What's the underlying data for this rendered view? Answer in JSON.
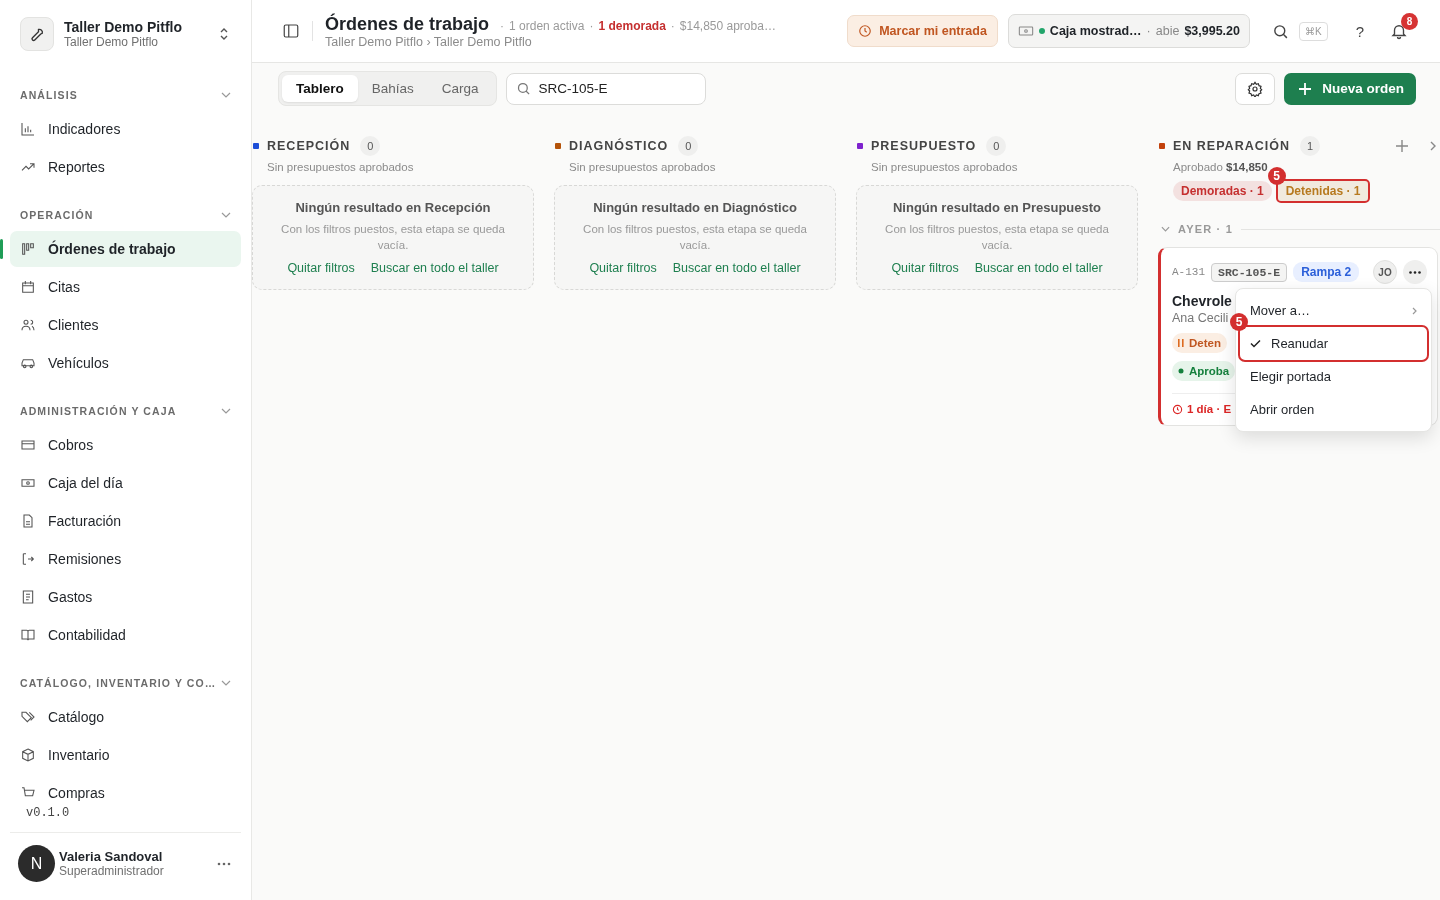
{
  "workspace": {
    "name": "Taller Demo Pitflo",
    "subtitle": "Taller Demo Pitflo"
  },
  "sidebar": {
    "sections": [
      {
        "title": "ANÁLISIS",
        "expanded": true,
        "items": [
          {
            "label": "Indicadores",
            "selected": false
          },
          {
            "label": "Reportes",
            "selected": false
          }
        ]
      },
      {
        "title": "OPERACIÓN",
        "expanded": true,
        "items": [
          {
            "label": "Órdenes de trabajo",
            "selected": true
          },
          {
            "label": "Citas",
            "selected": false
          },
          {
            "label": "Clientes",
            "selected": false
          },
          {
            "label": "Vehículos",
            "selected": false
          }
        ]
      },
      {
        "title": "ADMINISTRACIÓN Y CAJA",
        "expanded": true,
        "items": [
          {
            "label": "Cobros",
            "selected": false
          },
          {
            "label": "Caja del día",
            "selected": false
          },
          {
            "label": "Facturación",
            "selected": false
          },
          {
            "label": "Remisiones",
            "selected": false
          },
          {
            "label": "Gastos",
            "selected": false
          },
          {
            "label": "Contabilidad",
            "selected": false
          }
        ]
      },
      {
        "title": "CATÁLOGO, INVENTARIO Y CO…",
        "expanded": true,
        "items": [
          {
            "label": "Catálogo",
            "selected": false
          },
          {
            "label": "Inventario",
            "selected": false
          },
          {
            "label": "Compras",
            "selected": false
          }
        ]
      }
    ],
    "version": "v0.1.0",
    "user": {
      "initial": "N",
      "name": "Valeria Sandoval",
      "role": "Superadministrador"
    }
  },
  "header": {
    "title": "Órdenes de trabajo",
    "separator": "·",
    "meta": [
      {
        "text": "1 orden activa",
        "alert": false
      },
      {
        "text": "1 demorada",
        "alert": true
      },
      {
        "text": "$14,850 aproba…",
        "alert": false
      }
    ],
    "breadcrumb": "Taller Demo Pitflo › Taller Demo Pitflo",
    "clock_button": "Marcar mi entrada",
    "cash": {
      "open": true,
      "name": "Caja mostrad…",
      "separator": "·",
      "status": "abie",
      "amount": "$3,995.20"
    },
    "shortcut": "⌘K",
    "help": "?",
    "notifications": "8"
  },
  "toolbar": {
    "tabs": [
      {
        "label": "Tablero",
        "selected": true
      },
      {
        "label": "Bahías",
        "selected": false
      },
      {
        "label": "Carga",
        "selected": false
      }
    ],
    "search": {
      "value": "SRC-105-E"
    },
    "new_button": "Nueva orden"
  },
  "columns": [
    {
      "name": "RECEPCIÓN",
      "color": "#1d4ed8",
      "count": "0",
      "subtitle": "Sin presupuestos aprobados",
      "empty": {
        "title": "Ningún resultado en Recepción",
        "text": "Con los filtros puestos, esta etapa se queda vacía.",
        "actions": [
          "Quitar filtros",
          "Buscar en todo el taller"
        ]
      }
    },
    {
      "name": "DIAGNÓSTICO",
      "color": "#b45309",
      "count": "0",
      "subtitle": "Sin presupuestos aprobados",
      "empty": {
        "title": "Ningún resultado en Diagnóstico",
        "text": "Con los filtros puestos, esta etapa se queda vacía.",
        "actions": [
          "Quitar filtros",
          "Buscar en todo el taller"
        ]
      }
    },
    {
      "name": "PRESUPUESTO",
      "color": "#7e22ce",
      "count": "0",
      "subtitle": "Sin presupuestos aprobados",
      "empty": {
        "title": "Ningún resultado en Presupuesto",
        "text": "Con los filtros puestos, esta etapa se queda vacía.",
        "actions": [
          "Quitar filtros",
          "Buscar en todo el taller"
        ]
      }
    },
    {
      "name": "EN REPARACIÓN",
      "color": "#c2410c",
      "count": "1",
      "subtitle": "Aprobado **$14,850**",
      "chips": [
        {
          "label": "Demoradas · 1",
          "color": "#c53030"
        },
        {
          "label": "Detenidas · 1",
          "color": "#b7791f",
          "callout": "5"
        }
      ],
      "group": {
        "label": "AYER · 1",
        "expanded": true
      },
      "cards": [
        {
          "code": "A-131",
          "plate": "SRC-105-E",
          "bay": "Rampa 2",
          "assignee": "JO",
          "vehicle": "Chevrole",
          "customer": "Ana Cecili",
          "tags": [
            {
              "kind": "paused",
              "label": "Deten"
            },
            {
              "kind": "approved",
              "label": "Aproba"
            }
          ],
          "footer": "1 día · E",
          "menu": [
            {
              "label": "Mover a…",
              "kind": "submenu",
              "checked": false
            },
            {
              "label": "Reanudar",
              "kind": "item",
              "checked": true,
              "callout": "5"
            },
            {
              "label": "Elegir portada",
              "kind": "item",
              "checked": false
            },
            {
              "label": "Abrir orden",
              "kind": "item",
              "checked": false
            }
          ]
        }
      ]
    }
  ]
}
